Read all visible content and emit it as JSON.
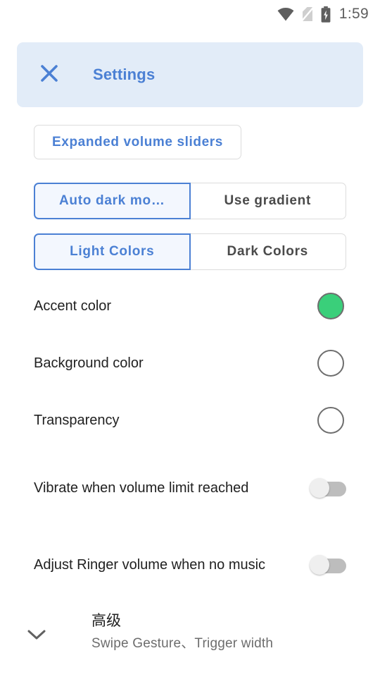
{
  "status_bar": {
    "wifi_icon": "wifi-icon",
    "sim_icon": "no-sim-icon",
    "battery_icon": "battery-charging-icon",
    "time": "1:59"
  },
  "header": {
    "close_icon": "close-icon",
    "title": "Settings",
    "background_color": "#e2ecf8",
    "accent_text_color": "#4b80d4"
  },
  "buttons": {
    "expanded_volume_sliders": "Expanded volume sliders"
  },
  "segmented_groups": [
    {
      "name": "dark-mode-group",
      "options": [
        {
          "label": "Auto dark mo…",
          "selected": true
        },
        {
          "label": "Use gradient",
          "selected": false
        }
      ]
    },
    {
      "name": "color-scheme-group",
      "options": [
        {
          "label": "Light Colors",
          "selected": true
        },
        {
          "label": "Dark Colors",
          "selected": false
        }
      ]
    }
  ],
  "preferences": [
    {
      "name": "accent-color",
      "label": "Accent color",
      "control": "color-swatch",
      "value_color": "#3acf7a"
    },
    {
      "name": "background-color",
      "label": "Background color",
      "control": "color-swatch",
      "value_color": "#ffffff"
    },
    {
      "name": "transparency",
      "label": "Transparency",
      "control": "color-swatch",
      "value_color": "#ffffff"
    },
    {
      "name": "vibrate-volume-limit",
      "label": "Vibrate when volume limit reached",
      "control": "switch",
      "checked": false
    },
    {
      "name": "adjust-ringer-no-music",
      "label": "Adjust Ringer volume when no music",
      "control": "switch",
      "checked": false
    }
  ],
  "advanced_section": {
    "expand_icon": "chevron-down-icon",
    "title": "高级",
    "subtitle": "Swipe Gesture、Trigger width",
    "expanded": false
  }
}
